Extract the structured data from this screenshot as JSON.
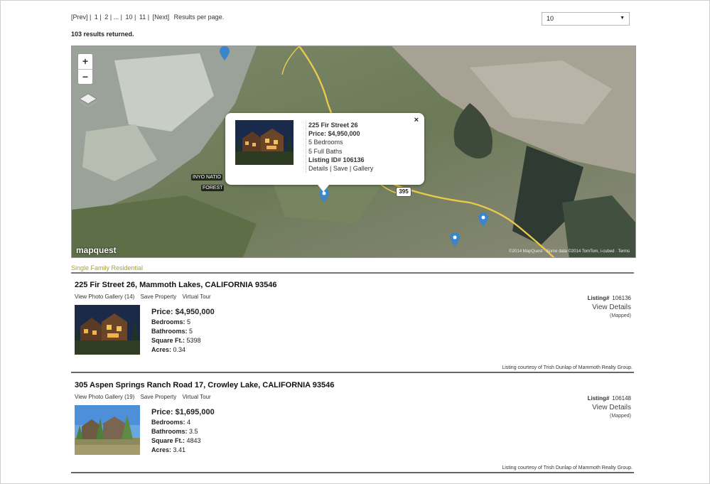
{
  "pagination": {
    "prev": "[Prev]",
    "sep1": "|",
    "p1": "1",
    "sep2": "|",
    "p2": "2",
    "sep3": "| ... |",
    "p10": "10",
    "sep4": "|",
    "p11": "11",
    "sep5": "|",
    "next": "[Next]",
    "per_page_label": "Results per page."
  },
  "per_page": {
    "value": "10"
  },
  "results_count": "103 results returned.",
  "map": {
    "zoom_in": "+",
    "zoom_out": "−",
    "label_forest_1": "INYO NATIO",
    "label_forest_2": "FOREST",
    "route": "395",
    "logo": "mapquest",
    "copyright": "©2014 MapQuest · Some data ©2014 TomTom, i-cubed · Terms",
    "popup": {
      "close": "×",
      "address": "225 Fir Street 26",
      "price": "Price: $4,950,000",
      "bedrooms": "5 Bedrooms",
      "baths": "5 Full Baths",
      "listing_id": "Listing ID# 106136",
      "links": "Details | Save | Gallery"
    }
  },
  "category": "Single Family Residential",
  "listings": [
    {
      "address": "225 Fir Street 26,  Mammoth Lakes,  CALIFORNIA 93546",
      "gallery": "View Photo Gallery (14)",
      "save": "Save Property",
      "tour": "Virtual Tour",
      "price": "Price: $4,950,000",
      "bedrooms_label": "Bedrooms:",
      "bedrooms": "5",
      "bathrooms_label": "Bathrooms:",
      "bathrooms": "5",
      "sqft_label": "Square Ft.:",
      "sqft": "5398",
      "acres_label": "Acres:",
      "acres": "0.34",
      "listing_label": "Listing#",
      "listing_no": "106136",
      "view_details": "View Details",
      "mapped": "(Mapped)",
      "courtesy": "Listing courtesy of Trish Dunlap of Mammoth Realty Group."
    },
    {
      "address": "305 Aspen Springs Ranch Road 17,  Crowley Lake,  CALIFORNIA 93546",
      "gallery": "View Photo Gallery (19)",
      "save": "Save Property",
      "tour": "Virtual Tour",
      "price": "Price: $1,695,000",
      "bedrooms_label": "Bedrooms:",
      "bedrooms": "4",
      "bathrooms_label": "Bathrooms:",
      "bathrooms": "3.5",
      "sqft_label": "Square Ft.:",
      "sqft": "4843",
      "acres_label": "Acres:",
      "acres": "3.41",
      "listing_label": "Listing#",
      "listing_no": "106148",
      "view_details": "View Details",
      "mapped": "(Mapped)",
      "courtesy": "Listing courtesy of Trish Dunlap of Mammoth Realty Group."
    }
  ],
  "colors": {
    "category": "#a9a037",
    "pin": "#3b86c8",
    "road": "#e8c94a"
  }
}
